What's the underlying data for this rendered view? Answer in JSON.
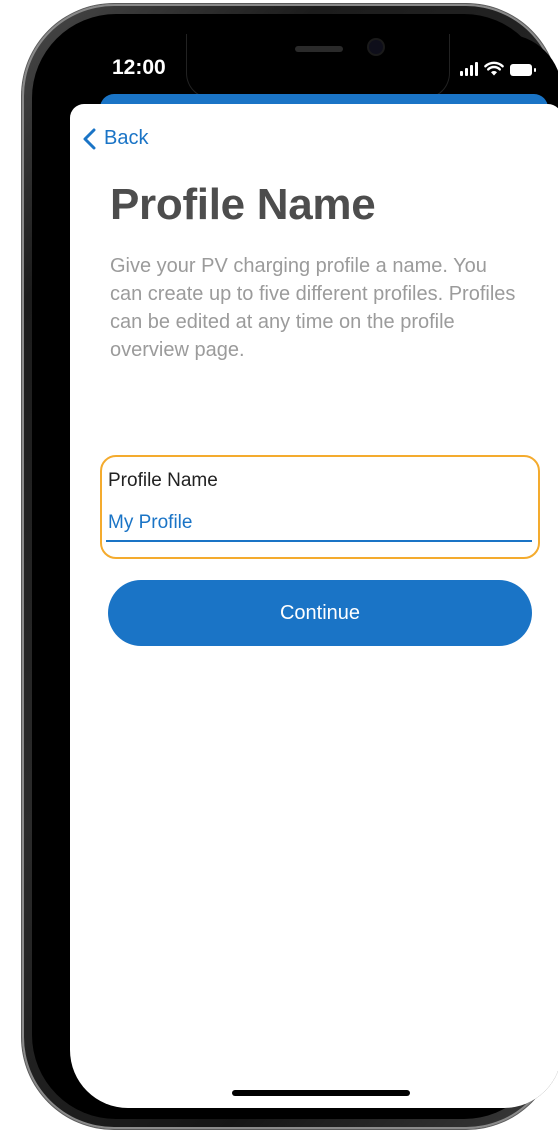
{
  "status_bar": {
    "time": "12:00",
    "icons": [
      "cellular-signal-icon",
      "wifi-icon",
      "battery-icon"
    ]
  },
  "nav": {
    "back_label": "Back",
    "back_icon": "chevron-left-icon"
  },
  "page": {
    "title": "Profile Name",
    "description": "Give your PV charging profile a name. You can create up to five different profiles. Profiles can be edited at any time on the profile overview page."
  },
  "form": {
    "field_label": "Profile Name",
    "field_value": "My Profile"
  },
  "actions": {
    "continue_label": "Continue"
  },
  "colors": {
    "accent": "#1a74c6",
    "focus_highlight": "#f4ab2e",
    "title_text": "#4d4d4d",
    "description_text": "#9b9b9b"
  }
}
